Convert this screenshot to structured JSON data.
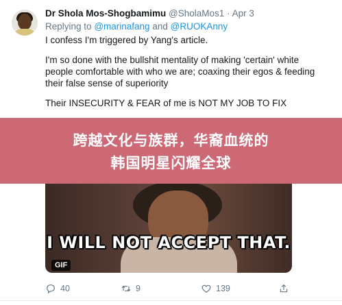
{
  "tweet": {
    "author_name": "Dr Shola Mos-Shogbamimu",
    "author_handle": "@SholaMos1",
    "separator": "·",
    "date": "Apr 3",
    "replying_to_prefix": "Replying to",
    "reply_mention_1": "@marinafang",
    "reply_conjunction": "and",
    "reply_mention_2": "@RUOKAnny",
    "paragraphs": [
      "I confess I'm triggered by Yang's article.",
      "I'm so done with the bullshit mentality of making 'certain' white people comfortable with who we are; coaxing their egos & feeding their false sense of superiority",
      "Their INSECURITY & FEAR of me is NOT MY JOB TO FIX"
    ],
    "media": {
      "caption": "I WILL NOT ACCEPT THAT.",
      "badge": "GIF"
    },
    "actions": {
      "reply_count": "40",
      "retweet_count": "9",
      "like_count": "139"
    }
  },
  "banner": {
    "line1": "跨越文化与族群，华裔血统的",
    "line2": "韩国明星闪耀全球"
  },
  "colors": {
    "banner": "#c65462",
    "link": "#1b95e0",
    "muted": "#657786"
  }
}
